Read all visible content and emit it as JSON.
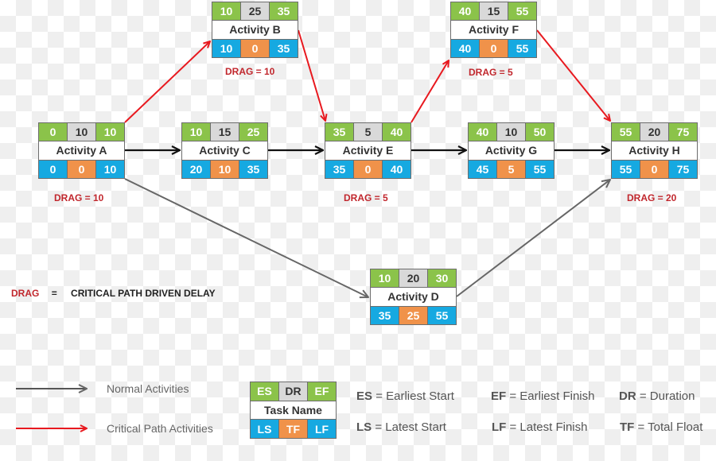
{
  "colors": {
    "es_ef": "#8bc34a",
    "duration": "#d9d9d9",
    "ls_lf": "#16a9e1",
    "float": "#f0924a",
    "critical_arrow": "#e8191f",
    "normal_arrow": "#666666",
    "sequential_arrow": "#111111",
    "drag_text": "#c1272d"
  },
  "activities": {
    "A": {
      "name": "Activity A",
      "es": "0",
      "dr": "10",
      "ef": "10",
      "ls": "0",
      "tf": "0",
      "lf": "10",
      "drag": "DRAG = 10"
    },
    "B": {
      "name": "Activity B",
      "es": "10",
      "dr": "25",
      "ef": "35",
      "ls": "10",
      "tf": "0",
      "lf": "35",
      "drag": "DRAG = 10"
    },
    "C": {
      "name": "Activity C",
      "es": "10",
      "dr": "15",
      "ef": "25",
      "ls": "20",
      "tf": "10",
      "lf": "35"
    },
    "D": {
      "name": "Activity D",
      "es": "10",
      "dr": "20",
      "ef": "30",
      "ls": "35",
      "tf": "25",
      "lf": "55"
    },
    "E": {
      "name": "Activity E",
      "es": "35",
      "dr": "5",
      "ef": "40",
      "ls": "35",
      "tf": "0",
      "lf": "40",
      "drag": "DRAG = 5"
    },
    "F": {
      "name": "Activity F",
      "es": "40",
      "dr": "15",
      "ef": "55",
      "ls": "40",
      "tf": "0",
      "lf": "55",
      "drag": "DRAG = 5"
    },
    "G": {
      "name": "Activity G",
      "es": "40",
      "dr": "10",
      "ef": "50",
      "ls": "45",
      "tf": "5",
      "lf": "55"
    },
    "H": {
      "name": "Activity H",
      "es": "55",
      "dr": "20",
      "ef": "75",
      "ls": "55",
      "tf": "0",
      "lf": "75",
      "drag": "DRAG = 20"
    }
  },
  "links": [
    {
      "from": "A",
      "to": "B",
      "type": "critical"
    },
    {
      "from": "B",
      "to": "E",
      "type": "critical"
    },
    {
      "from": "E",
      "to": "F",
      "type": "critical"
    },
    {
      "from": "F",
      "to": "H",
      "type": "critical"
    },
    {
      "from": "A",
      "to": "C",
      "type": "sequential"
    },
    {
      "from": "C",
      "to": "E",
      "type": "sequential"
    },
    {
      "from": "E",
      "to": "G",
      "type": "sequential"
    },
    {
      "from": "G",
      "to": "H",
      "type": "sequential"
    },
    {
      "from": "A",
      "to": "D",
      "type": "normal"
    },
    {
      "from": "D",
      "to": "H",
      "type": "normal"
    }
  ],
  "drag_definition": {
    "term": "DRAG",
    "equals": "=",
    "meaning": "CRITICAL PATH DRIVEN DELAY"
  },
  "legend": {
    "normal": "Normal Activities",
    "critical": "Critical Path Activities",
    "key_box": {
      "es": "ES",
      "dr": "DR",
      "ef": "EF",
      "name": "Task Name",
      "ls": "LS",
      "tf": "TF",
      "lf": "LF"
    },
    "definitions": [
      {
        "abbr": "ES",
        "text": "= Earliest Start"
      },
      {
        "abbr": "EF",
        "text": "= Earliest Finish"
      },
      {
        "abbr": "DR",
        "text": "= Duration"
      },
      {
        "abbr": "LS",
        "text": "= Latest Start"
      },
      {
        "abbr": "LF",
        "text": "= Latest Finish"
      },
      {
        "abbr": "TF",
        "text": "= Total Float"
      }
    ]
  }
}
